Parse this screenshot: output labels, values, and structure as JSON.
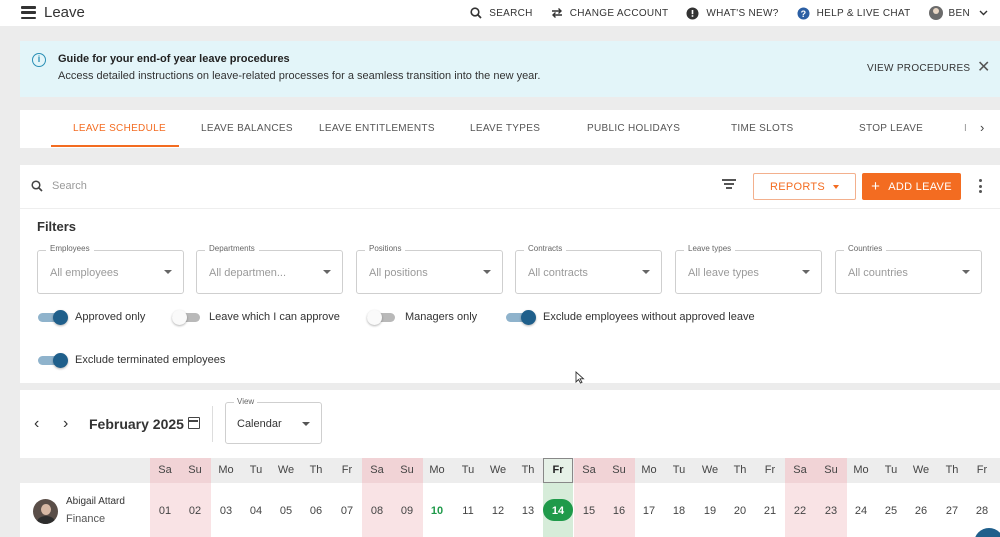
{
  "app": {
    "title": "Leave"
  },
  "topbar": {
    "search": "SEARCH",
    "change_account": "CHANGE ACCOUNT",
    "whats_new": "WHAT'S NEW?",
    "help": "HELP & LIVE CHAT",
    "user": "BEN"
  },
  "banner": {
    "title": "Guide for your end-of year leave procedures",
    "text": "Access detailed instructions on leave-related processes for a seamless transition into the new year.",
    "link": "VIEW PROCEDURES",
    "close": "✕"
  },
  "tabs": [
    "LEAVE SCHEDULE",
    "LEAVE BALANCES",
    "LEAVE ENTITLEMENTS",
    "LEAVE TYPES",
    "PUBLIC HOLIDAYS",
    "TIME SLOTS",
    "STOP LEAVE"
  ],
  "tab_more": "I",
  "toolbar": {
    "search_placeholder": "Search",
    "reports_label": "REPORTS",
    "add_label": "ADD LEAVE"
  },
  "filters": {
    "title": "Filters",
    "selects": [
      {
        "label": "Employees",
        "value": "All employees"
      },
      {
        "label": "Departments",
        "value": "All departmen..."
      },
      {
        "label": "Positions",
        "value": "All positions"
      },
      {
        "label": "Contracts",
        "value": "All contracts"
      },
      {
        "label": "Leave types",
        "value": "All leave types"
      },
      {
        "label": "Countries",
        "value": "All countries"
      }
    ],
    "toggles": [
      {
        "label": "Approved only",
        "on": true
      },
      {
        "label": "Leave which I can approve",
        "on": false
      },
      {
        "label": "Managers only",
        "on": false
      },
      {
        "label": "Exclude employees without approved leave",
        "on": true
      },
      {
        "label": "Exclude terminated employees",
        "on": true
      }
    ]
  },
  "calendar": {
    "month": "February 2025",
    "view_label": "View",
    "view_value": "Calendar",
    "day_names": [
      "Sa",
      "Su",
      "Mo",
      "Tu",
      "We",
      "Th",
      "Fr",
      "Sa",
      "Su",
      "Mo",
      "Tu",
      "We",
      "Th",
      "Fr",
      "Sa",
      "Su",
      "Mo",
      "Tu",
      "We",
      "Th",
      "Fr",
      "Sa",
      "Su",
      "Mo",
      "Tu",
      "We",
      "Th",
      "Fr"
    ],
    "days": [
      "01",
      "02",
      "03",
      "04",
      "05",
      "06",
      "07",
      "08",
      "09",
      "10",
      "11",
      "12",
      "13",
      "14",
      "15",
      "16",
      "17",
      "18",
      "19",
      "20",
      "21",
      "22",
      "23",
      "24",
      "25",
      "26",
      "27",
      "28"
    ],
    "today": "14",
    "highlight_day": "10"
  },
  "employee": {
    "name": "Abigail Attard",
    "department": "Finance"
  },
  "colors": {
    "accent": "#f36c21",
    "toggle_on": "#1f5f8b",
    "today": "#1f9a4a",
    "weekend": "#f9e3e5",
    "banner_bg": "#e3f5f9"
  }
}
